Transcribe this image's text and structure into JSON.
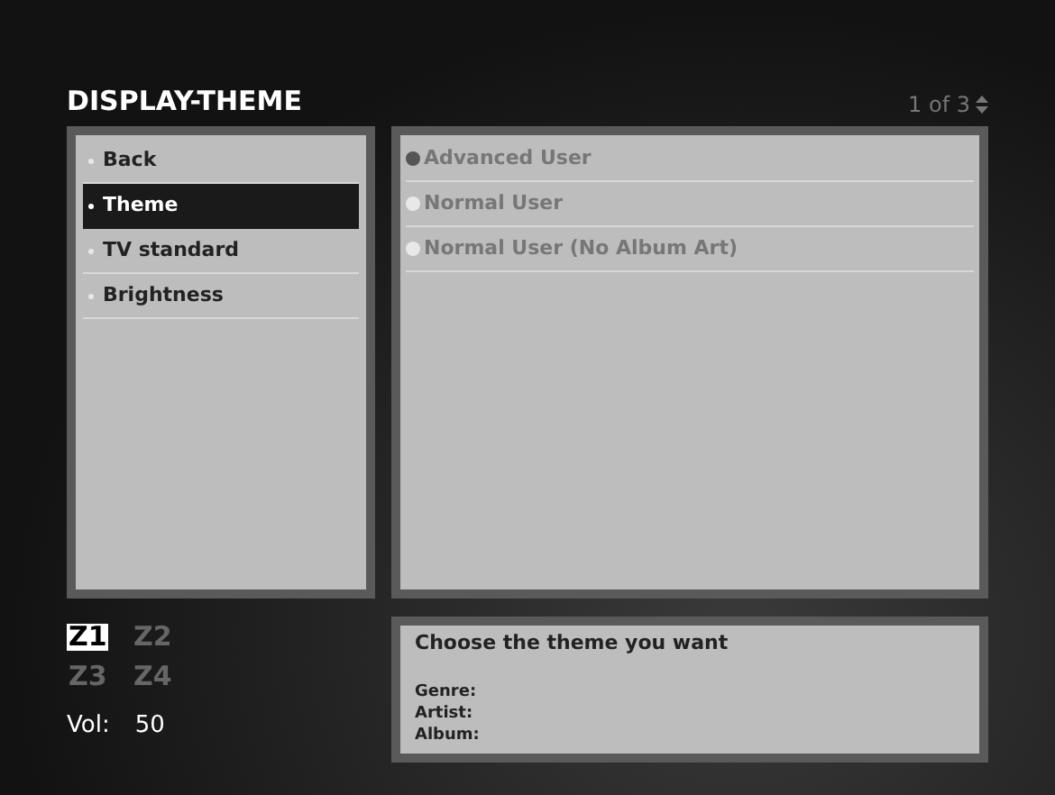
{
  "title": "DISPLAY-THEME",
  "page_indicator": "1 of 3",
  "menu": [
    {
      "label": "Back",
      "selected": false
    },
    {
      "label": "Theme",
      "selected": true
    },
    {
      "label": "TV standard",
      "selected": false
    },
    {
      "label": "Brightness",
      "selected": false
    }
  ],
  "options": [
    {
      "label": "Advanced User",
      "selected": true
    },
    {
      "label": "Normal User",
      "selected": false
    },
    {
      "label": "Normal User (No Album Art)",
      "selected": false
    }
  ],
  "zones": [
    {
      "label": "Z1",
      "selected": true
    },
    {
      "label": "Z2",
      "selected": false
    },
    {
      "label": "Z3",
      "selected": false
    },
    {
      "label": "Z4",
      "selected": false
    }
  ],
  "volume": {
    "label": "Vol:",
    "value": "50"
  },
  "info": {
    "heading": "Choose the theme you want",
    "fields": [
      "Genre:",
      "Artist:",
      "Album:"
    ]
  }
}
